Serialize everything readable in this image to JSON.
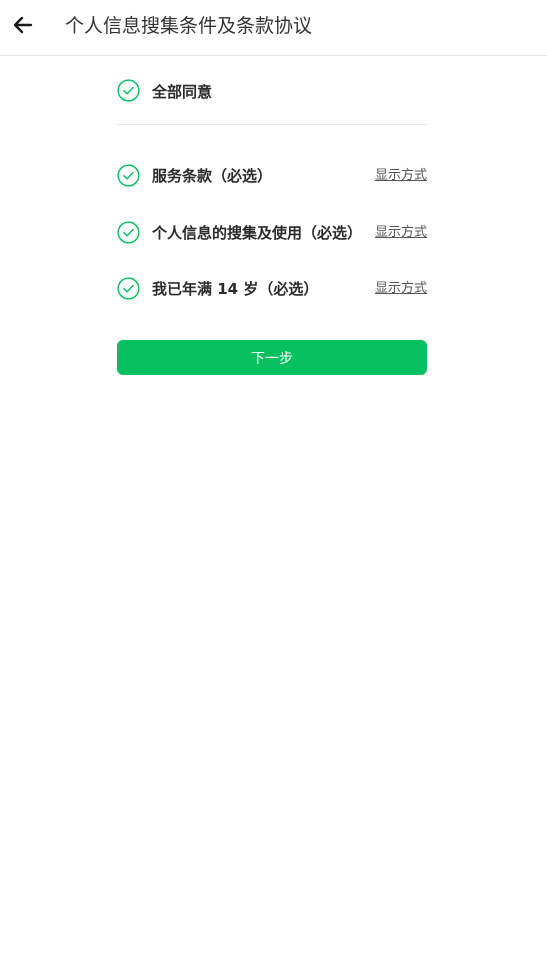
{
  "header": {
    "back_icon": "arrow-left-icon",
    "title": "个人信息搜集条件及条款协议"
  },
  "agree_all": {
    "label": "全部同意",
    "checked": true,
    "icon": "check-circle-icon"
  },
  "terms": [
    {
      "label": "服务条款（必选）",
      "link": "显示方式",
      "checked": true
    },
    {
      "label": "个人信息的搜集及使用（必选）",
      "link": "显示方式",
      "checked": true
    },
    {
      "label": "我已年满 14 岁（必选）",
      "link": "显示方式",
      "checked": true
    }
  ],
  "next_button": {
    "label": "下一步"
  },
  "colors": {
    "accent": "#07c160",
    "check_green": "#07c160",
    "text": "#2b2b2b",
    "divider": "#e8e8e8"
  }
}
